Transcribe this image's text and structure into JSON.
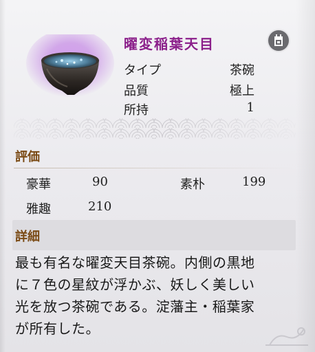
{
  "item": {
    "name": "曜変稲葉天目",
    "image_icon": "tea-bowl-icon",
    "glow_color": "#b86be0"
  },
  "stats": [
    {
      "label": "タイプ",
      "value": "茶碗"
    },
    {
      "label": "品質",
      "value": "極上"
    },
    {
      "label": "所持",
      "value": "1"
    }
  ],
  "evaluation": {
    "title": "評価",
    "items": [
      {
        "label": "豪華",
        "value": "90"
      },
      {
        "label": "素朴",
        "value": "199"
      },
      {
        "label": "雅趣",
        "value": "210"
      }
    ]
  },
  "detail": {
    "title": "詳細",
    "lines": [
      "最も有名な曜変天目茶碗。内側の黒地",
      "に７色の星紋が浮かぶ、妖しく美しい",
      "光を放つ茶碗である。淀藩主・稲葉家",
      "が所有した。"
    ]
  },
  "colors": {
    "name": "#8b1f8a",
    "section_title": "#7a4a14",
    "icon_bg": "#6a6a6e"
  }
}
